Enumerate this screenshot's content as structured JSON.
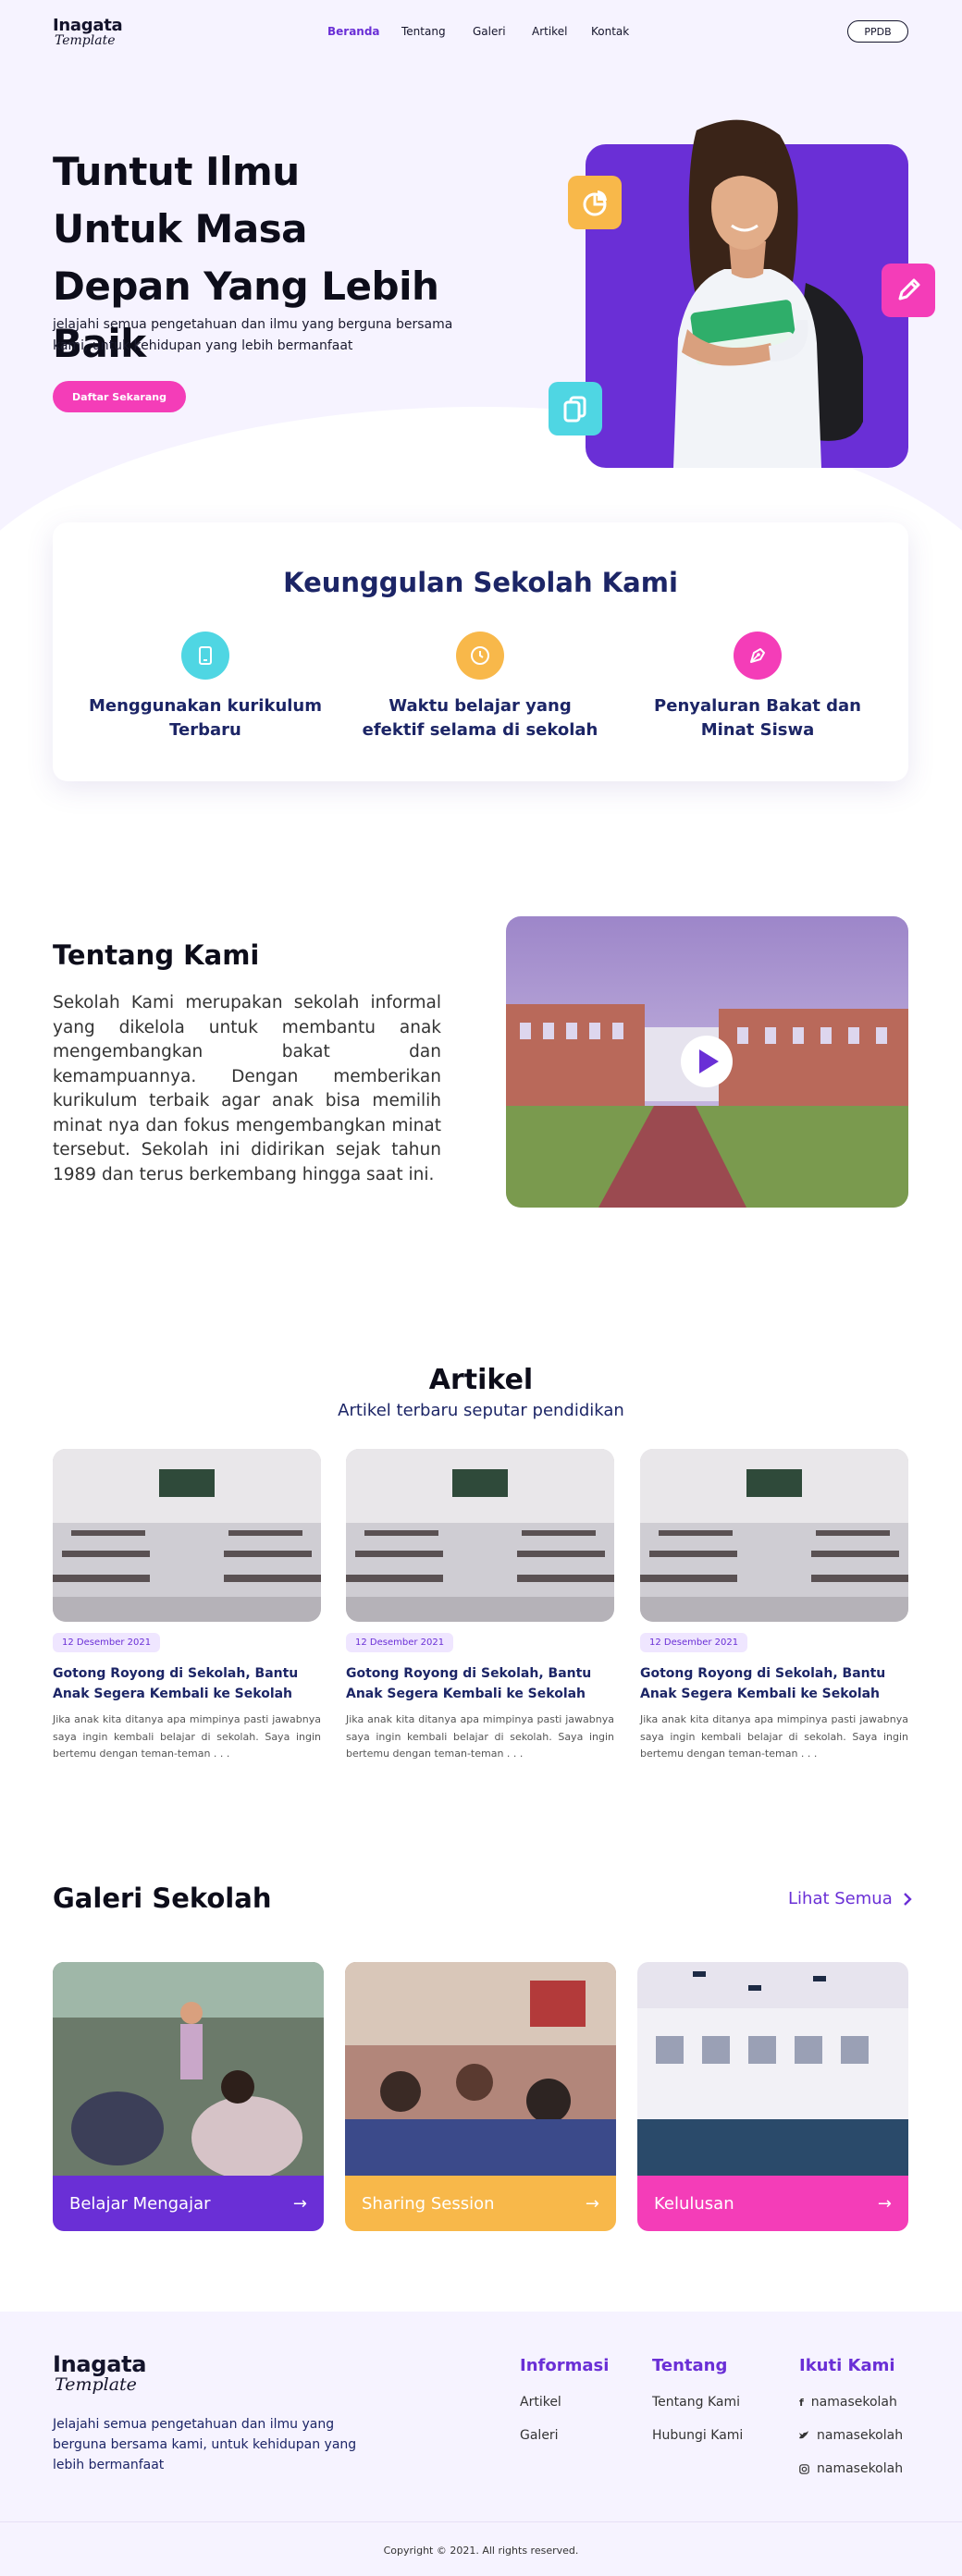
{
  "brand": {
    "name": "Inagata",
    "tagline": "Template"
  },
  "nav": {
    "items": [
      {
        "label": "Beranda",
        "active": true
      },
      {
        "label": "Tentang"
      },
      {
        "label": "Galeri"
      },
      {
        "label": "Artikel"
      },
      {
        "label": "Kontak"
      }
    ],
    "cta": "PPDB"
  },
  "hero": {
    "title": "Tuntut Ilmu Untuk Masa Depan Yang Lebih Baik",
    "subtitle": "jelajahi semua pengetahuan dan ilmu yang berguna bersama kami, untuk kehidupan yang lebih bermanfaat",
    "button": "Daftar Sekarang",
    "icons": [
      "chart-pie-icon",
      "pencil-icon",
      "copy-icon"
    ]
  },
  "advantages": {
    "title": "Keunggulan Sekolah Kami",
    "items": [
      {
        "label": "Menggunakan kurikulum Terbaru",
        "icon": "tablet-icon",
        "color": "#4fd6e3"
      },
      {
        "label": "Waktu belajar yang efektif selama di sekolah",
        "icon": "clock-icon",
        "color": "#f8b84a"
      },
      {
        "label": "Penyaluran Bakat dan Minat Siswa",
        "icon": "pen-nib-icon",
        "color": "#f43db8"
      }
    ]
  },
  "about": {
    "title": "Tentang Kami",
    "text": "Sekolah Kami merupakan sekolah informal yang dikelola untuk membantu anak mengembangkan bakat dan kemampuannya. Dengan memberikan kurikulum terbaik agar anak bisa memilih minat nya dan fokus mengembangkan minat tersebut. Sekolah ini didirikan sejak tahun 1989 dan terus berkembang hingga saat ini."
  },
  "articles": {
    "title": "Artikel",
    "subtitle": "Artikel terbaru seputar pendidikan",
    "items": [
      {
        "date": "12 Desember 2021",
        "title": "Gotong Royong di Sekolah, Bantu Anak Segera Kembali ke Sekolah",
        "desc": "Jika anak kita ditanya apa mimpinya pasti jawabnya saya ingin kembali belajar di sekolah. Saya ingin bertemu dengan teman-teman . . ."
      },
      {
        "date": "12 Desember 2021",
        "title": "Gotong Royong di Sekolah, Bantu Anak Segera Kembali ke Sekolah",
        "desc": "Jika anak kita ditanya apa mimpinya pasti jawabnya saya ingin kembali belajar di sekolah. Saya ingin bertemu dengan teman-teman . . ."
      },
      {
        "date": "12 Desember 2021",
        "title": "Gotong Royong di Sekolah, Bantu Anak Segera Kembali ke Sekolah",
        "desc": "Jika anak kita ditanya apa mimpinya pasti jawabnya saya ingin kembali belajar di sekolah. Saya ingin bertemu dengan teman-teman . . ."
      }
    ]
  },
  "gallery": {
    "title": "Galeri Sekolah",
    "see_all": "Lihat Semua",
    "items": [
      {
        "label": "Belajar Mengajar",
        "color": "#6a2fd6"
      },
      {
        "label": "Sharing Session",
        "color": "#f8b84a"
      },
      {
        "label": "Kelulusan",
        "color": "#f43db8"
      }
    ]
  },
  "footer": {
    "description": "Jelajahi semua pengetahuan dan ilmu yang berguna bersama kami, untuk kehidupan yang lebih bermanfaat",
    "informasi": {
      "title": "Informasi",
      "links": [
        "Artikel",
        "Galeri"
      ]
    },
    "tentang": {
      "title": "Tentang",
      "links": [
        "Tentang Kami",
        "Hubungi Kami"
      ]
    },
    "ikuti": {
      "title": "Ikuti Kami",
      "links": [
        {
          "icon": "facebook-icon",
          "label": "namasekolah"
        },
        {
          "icon": "twitter-icon",
          "label": "namasekolah"
        },
        {
          "icon": "instagram-icon",
          "label": "namasekolah"
        }
      ]
    },
    "copyright": "Copyright © 2021. All rights reserved."
  },
  "colors": {
    "primary": "#6a2fd6",
    "pink": "#f43db8",
    "yellow": "#f8b84a",
    "cyan": "#4fd6e3",
    "navy": "#1c2566"
  }
}
